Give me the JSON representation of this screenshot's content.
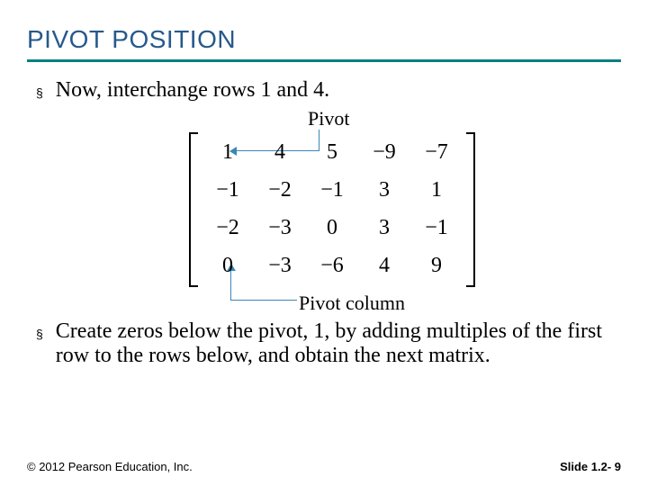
{
  "title": "PIVOT POSITION",
  "bullets": {
    "b1": "Now, interchange rows 1 and 4.",
    "b2": "Create zeros below the pivot, 1, by adding multiples of the first row to the rows below, and obtain the next matrix."
  },
  "labels": {
    "pivot": "Pivot",
    "pivot_column": "Pivot column"
  },
  "matrix": {
    "r0": {
      "c0": "1",
      "c1": "4",
      "c2": "5",
      "c3": "−9",
      "c4": "−7"
    },
    "r1": {
      "c0": "−1",
      "c1": "−2",
      "c2": "−1",
      "c3": "3",
      "c4": "1"
    },
    "r2": {
      "c0": "−2",
      "c1": "−3",
      "c2": "0",
      "c3": "3",
      "c4": "−1"
    },
    "r3": {
      "c0": "0",
      "c1": "−3",
      "c2": "−6",
      "c3": "4",
      "c4": "9"
    }
  },
  "footer": {
    "copyright": "© 2012 Pearson Education, Inc.",
    "slide": "Slide 1.2- 9"
  },
  "bullet_mark": "§"
}
